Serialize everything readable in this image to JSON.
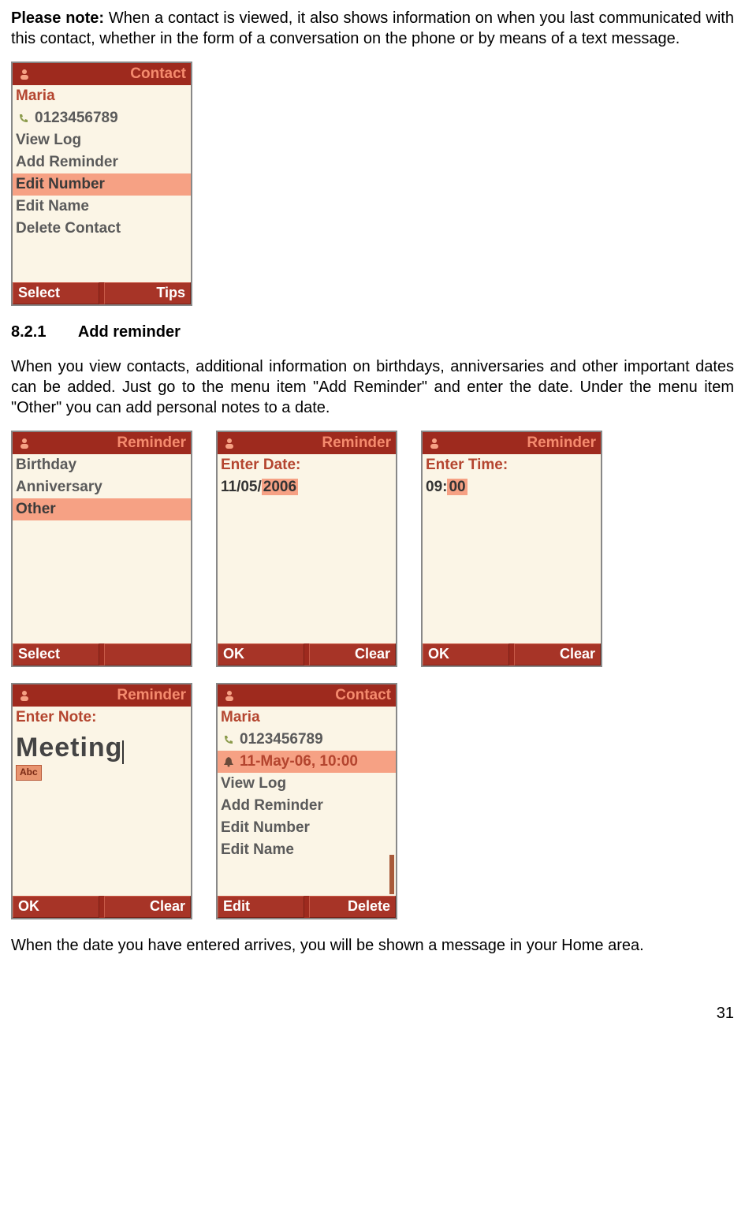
{
  "intro": {
    "bold": "Please note:",
    "rest": " When a contact is viewed, it also shows information on when you last communicated with this contact, whether in the form of a conversation on the phone or by means of a text message."
  },
  "screens": {
    "contact1": {
      "title": "Contact",
      "name": "Maria",
      "number": "0123456789",
      "items": [
        "View Log",
        "Add Reminder",
        "Edit Number",
        "Edit Name",
        "Delete Contact"
      ],
      "sk_left": "Select",
      "sk_right": "Tips"
    },
    "rem_list": {
      "title": "Reminder",
      "items": [
        "Birthday",
        "Anniversary",
        "Other"
      ],
      "sk_left": "Select",
      "sk_right": ""
    },
    "rem_date": {
      "title": "Reminder",
      "label": "Enter Date:",
      "value_pre": "11/05/",
      "value_hl": "2006",
      "sk_left": "OK",
      "sk_right": "Clear"
    },
    "rem_time": {
      "title": "Reminder",
      "label": "Enter Time:",
      "value_pre": "09:",
      "value_hl": "00",
      "sk_left": "OK",
      "sk_right": "Clear"
    },
    "rem_note": {
      "title": "Reminder",
      "label": "Enter Note:",
      "value": "Meeting",
      "badge": "Abc",
      "sk_left": "OK",
      "sk_right": "Clear"
    },
    "contact2": {
      "title": "Contact",
      "name": "Maria",
      "number": "0123456789",
      "reminder": "11-May-06, 10:00",
      "items": [
        "View Log",
        "Add Reminder",
        "Edit Number",
        "Edit Name"
      ],
      "sk_left": "Edit",
      "sk_right": "Delete"
    }
  },
  "heading": {
    "num": "8.2.1",
    "title": "Add reminder"
  },
  "para2": "When you view contacts, additional information on birthdays, anniversaries and other important dates can be added. Just go to the menu item \"Add Reminder\" and enter the date. Under the menu item \"Other\" you can add personal notes to a date.",
  "para3": "When the date you have entered arrives, you will be shown a message in your Home area.",
  "pagenum": "31"
}
